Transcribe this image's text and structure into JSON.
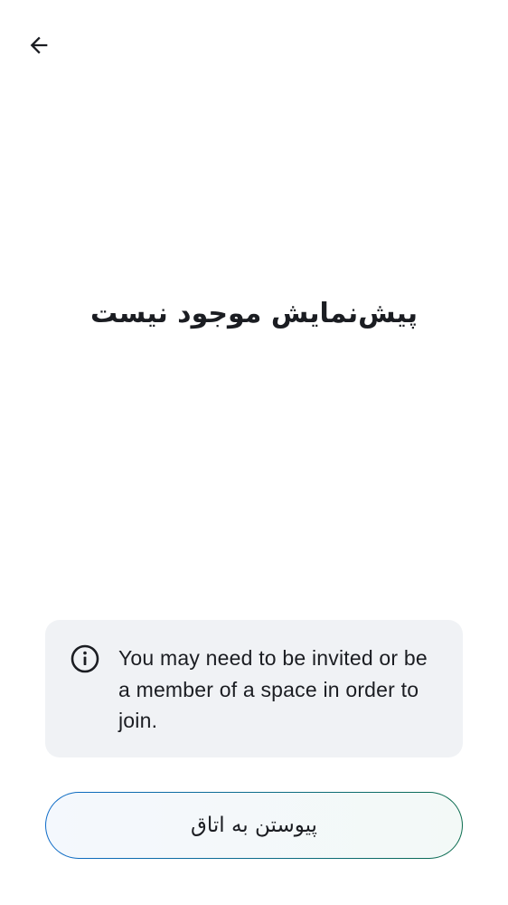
{
  "header": {
    "back_icon": "arrow-left-icon"
  },
  "main": {
    "title": "پیش‌نمایش موجود نیست"
  },
  "notice": {
    "icon": "info-icon",
    "text": "You may need to be invited or be a member of a space in order to join."
  },
  "join_button": {
    "label": "پیوستن به اتاق",
    "border_colors": [
      "#0d6bc9",
      "#0b6c4e"
    ]
  }
}
